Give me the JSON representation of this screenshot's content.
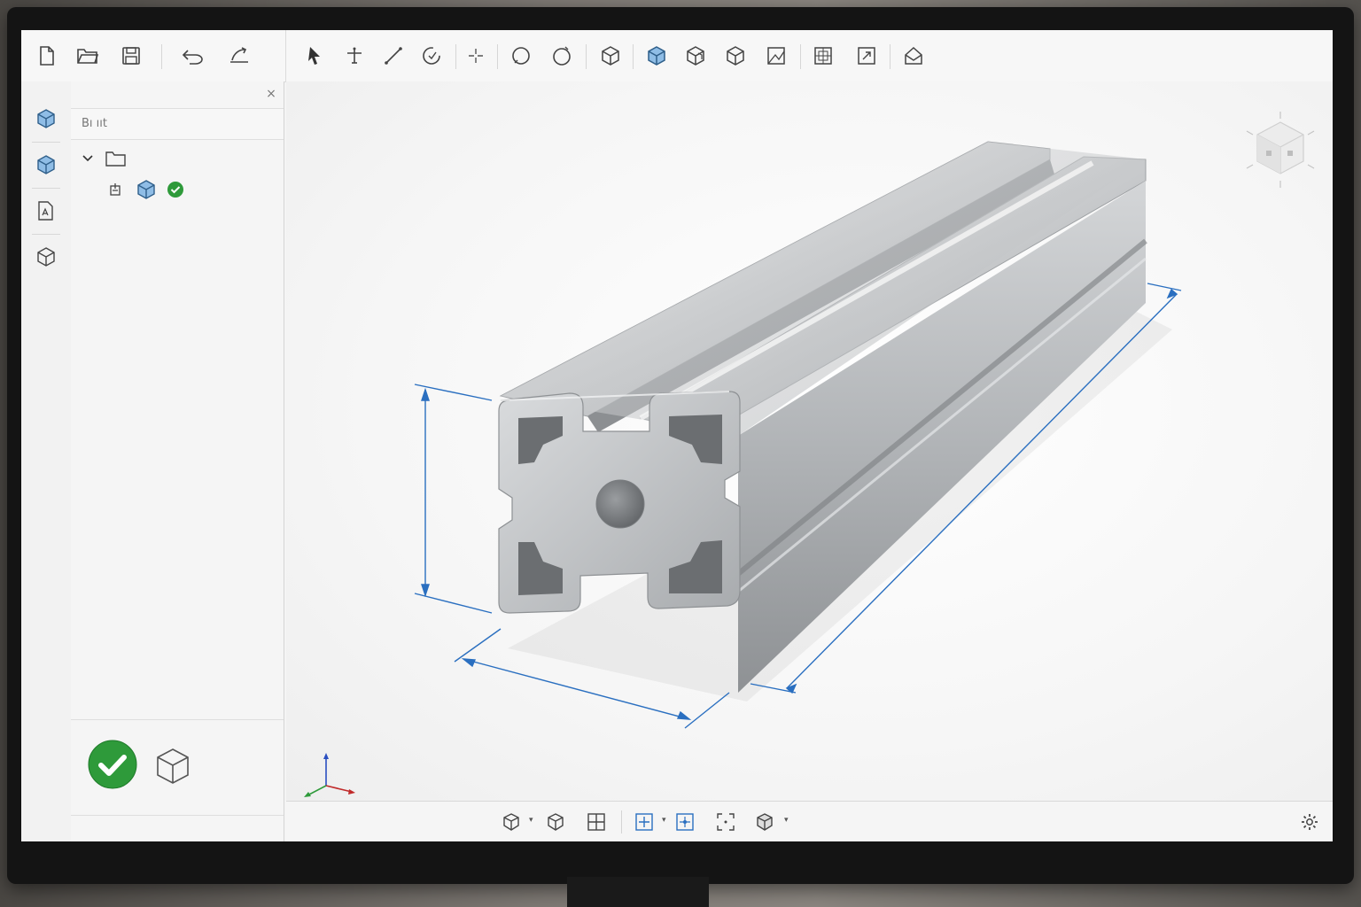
{
  "colors": {
    "accent_blue": "#2a6fc0",
    "confirm_green": "#2e9a3a",
    "metal": "#b9bcbf",
    "cube_blue": "#8fbde6"
  },
  "toolbar": {
    "file_icons": [
      "new-file-icon",
      "open-folder-icon",
      "save-icon"
    ],
    "edit_icons": [
      "undo-icon",
      "redo-icon"
    ],
    "sketch_icons": [
      "select-arrow-icon",
      "move-icon",
      "line-icon",
      "arc-icon",
      "point-icon"
    ],
    "shape_icons": [
      "circle-icon",
      "circle-arc-icon"
    ],
    "solid_icons": [
      "box-icon",
      "extrude-icon",
      "revolve-icon",
      "shell-icon",
      "chamfer-icon"
    ],
    "misc_icons": [
      "section-icon",
      "fit-view-icon",
      "export-icon"
    ]
  },
  "rail": {
    "icons": [
      "part-icon",
      "body-icon",
      "drawing-icon",
      "component-icon"
    ]
  },
  "tree_panel": {
    "search_text": "Bı ııt",
    "close_glyph": "×"
  },
  "viewcube": {
    "icon": "view-cube-icon"
  },
  "footer": {
    "confirm_icon": "checkmark-icon",
    "part_icon": "cube-outline-icon"
  },
  "bottom_bar": {
    "icons": [
      "view-style-icon",
      "view-cube-small-icon",
      "grid-icon",
      "snap-icon",
      "snap-center-icon",
      "zoom-extents-icon",
      "display-mode-icon"
    ],
    "settings_icon": "settings-gear-icon"
  }
}
